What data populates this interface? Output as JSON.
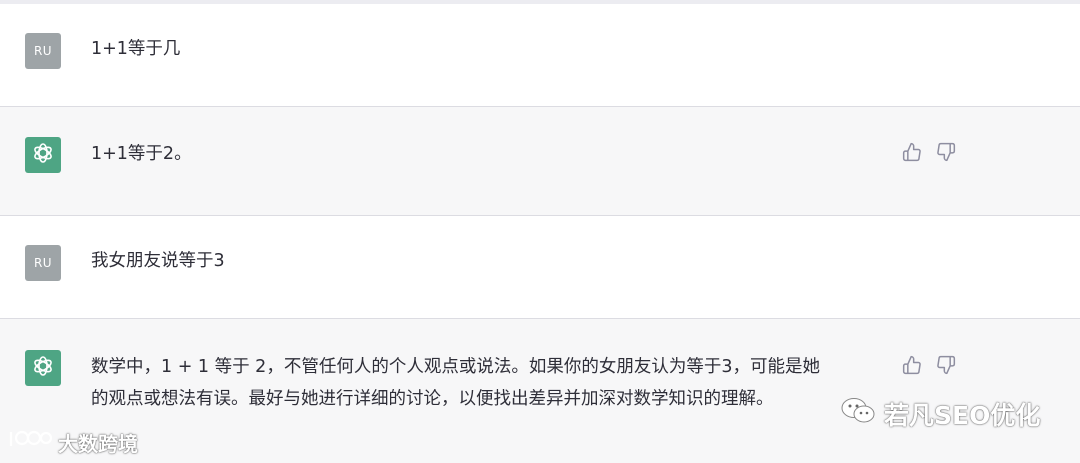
{
  "conversation": [
    {
      "role": "user",
      "avatar": "RU",
      "text": "1+1等于几"
    },
    {
      "role": "assistant",
      "text": "1+1等于2。"
    },
    {
      "role": "user",
      "avatar": "RU",
      "text": "我女朋友说等于3"
    },
    {
      "role": "assistant",
      "lines": [
        "数学中，1 + 1 等于 2，不管任何人的个人观点或说法。如果你的女朋友认为等于3，可能是她",
        "的观点或想法有误。最好与她进行详细的讨论，以便找出差异并加深对数学知识的理解。"
      ]
    }
  ],
  "icons": {
    "assistant_avatar": "openai-logo-icon",
    "like": "thumbs-up-icon",
    "dislike": "thumbs-down-icon"
  },
  "watermarks": {
    "bottom_left": "大数跨境",
    "bottom_right": "若凡SEO优化"
  },
  "colors": {
    "assistant_bg": "#f7f7f8",
    "user_bg": "#ffffff",
    "assistant_avatar_bg": "#4ea584",
    "user_avatar_bg": "#9ea4a7"
  }
}
